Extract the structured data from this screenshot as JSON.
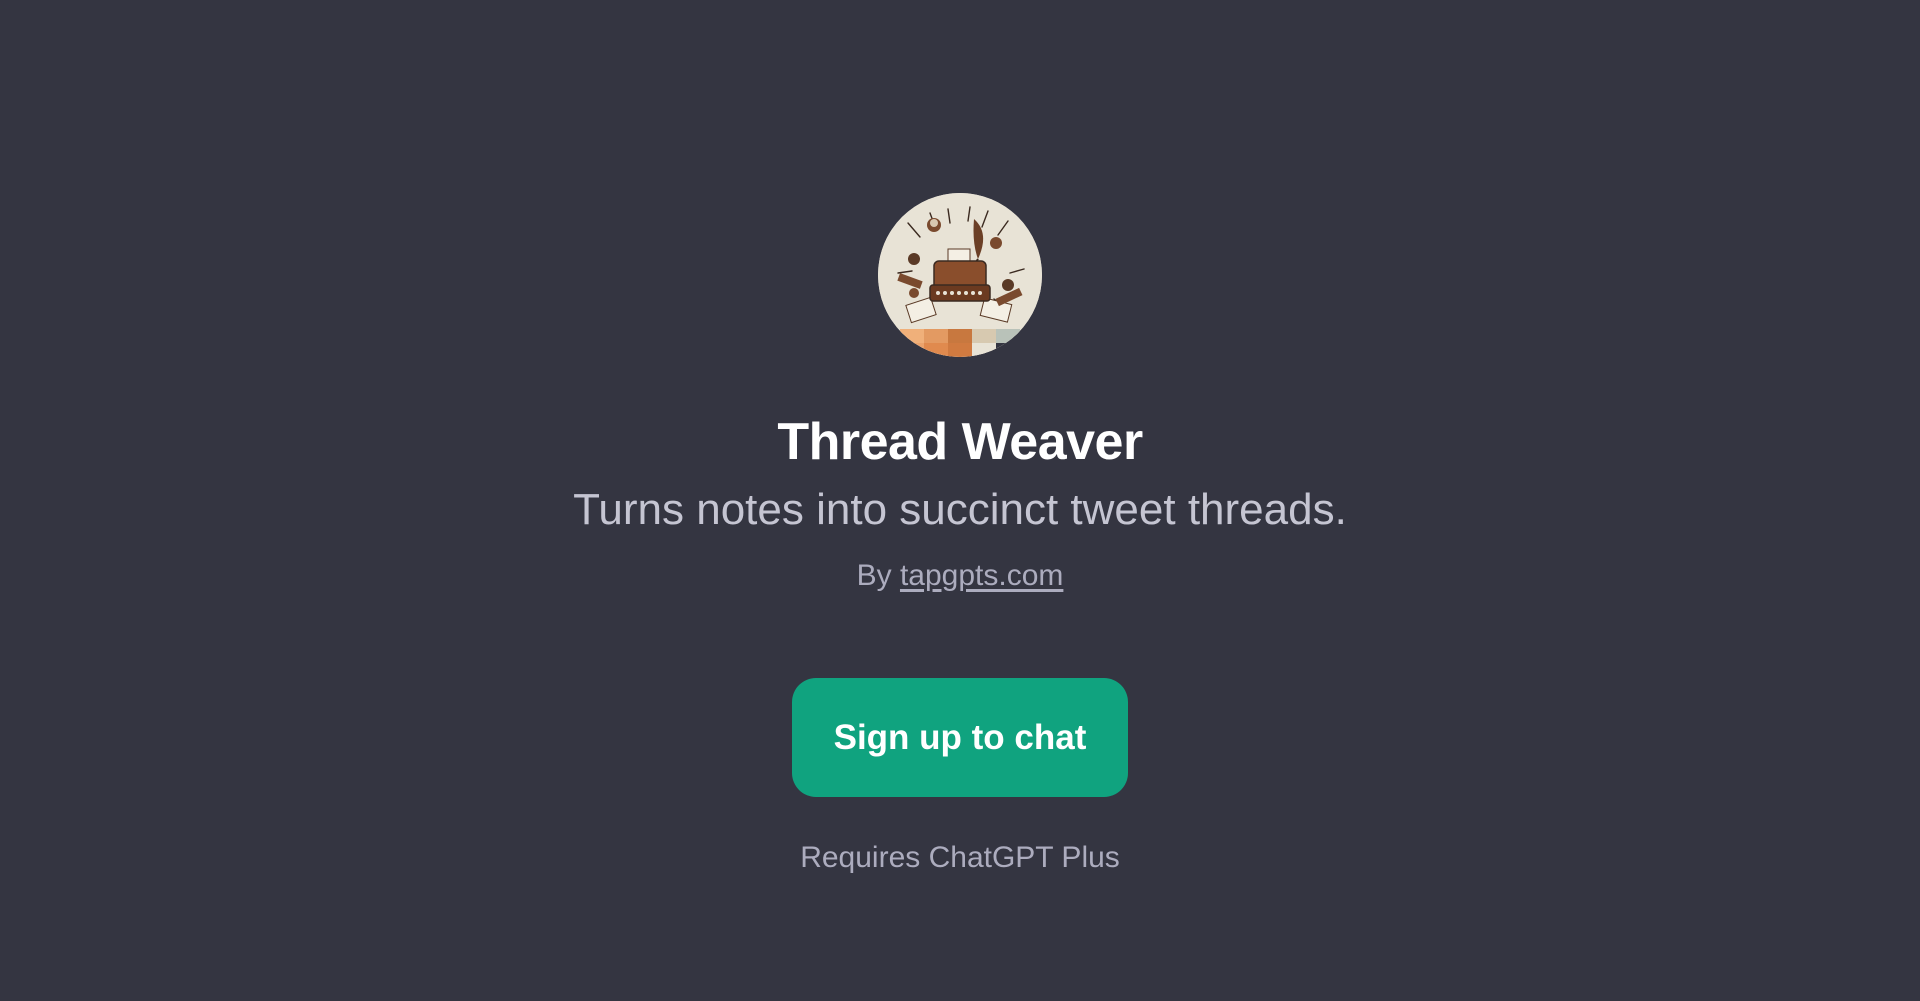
{
  "gpt": {
    "name": "Thread Weaver",
    "description": "Turns notes into succinct tweet threads.",
    "by_prefix": "By",
    "author": "tapgpts.com",
    "avatar_icon": "typewriter-illustration-icon"
  },
  "cta": {
    "label": "Sign up to chat"
  },
  "footer": {
    "requirement": "Requires ChatGPT Plus"
  },
  "colors": {
    "background": "#343541",
    "button": "#10a37f",
    "title": "#ffffff",
    "subtitle": "#c5c5d2",
    "muted": "#acacbe"
  }
}
